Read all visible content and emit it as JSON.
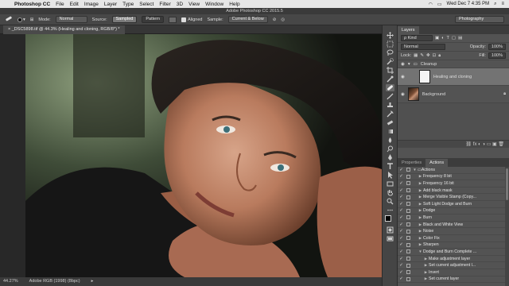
{
  "menubar": {
    "app": "Photoshop CC",
    "items": [
      "File",
      "Edit",
      "Image",
      "Layer",
      "Type",
      "Select",
      "Filter",
      "3D",
      "View",
      "Window",
      "Help"
    ],
    "clock": "Wed Dec 7  4:35 PM",
    "battery": "▭"
  },
  "window": {
    "title": "Adobe Photoshop CC 2015.5"
  },
  "options": {
    "mode_label": "Mode:",
    "mode_value": "Normal",
    "source_label": "Source:",
    "sampled_label": "Sampled",
    "pattern_label": "Pattern",
    "aligned_label": "Aligned",
    "sample_label": "Sample:",
    "sample_value": "Current & Below",
    "workspace": "Photography"
  },
  "document": {
    "tab_title": "_DSC5898.tif @ 44.3% (Healing and cloning, RGB/8*) *",
    "status_zoom": "44.27%",
    "status_profile": "Adobe RGB (1998) (8bpc)"
  },
  "layers_panel": {
    "tab": "Layers",
    "kind_label": "ρ Kind",
    "blend_mode": "Normal",
    "opacity_label": "Opacity:",
    "opacity_value": "100%",
    "lock_label": "Lock:",
    "fill_label": "Fill:",
    "fill_value": "100%",
    "group_name": "Cleanup",
    "layers": [
      "Healing and cloning",
      "Background"
    ],
    "footer_icons": "⛓ fx ◐ ◑ ▭ ▣ 🗑"
  },
  "actions_panel": {
    "tabs": [
      "Properties",
      "Actions"
    ],
    "items": [
      {
        "label": "Actions",
        "level": 0,
        "type": "set"
      },
      {
        "label": "Frequency 8 bit",
        "level": 1
      },
      {
        "label": "Frequency 16 bit",
        "level": 1
      },
      {
        "label": "Add black mask",
        "level": 1
      },
      {
        "label": "Merge Visible Stamp (Copy...",
        "level": 1
      },
      {
        "label": "Soft Light Dodge and Burn",
        "level": 1
      },
      {
        "label": "Dodge",
        "level": 1
      },
      {
        "label": "Burn",
        "level": 1
      },
      {
        "label": "Black and White View",
        "level": 1
      },
      {
        "label": "Noise",
        "level": 1
      },
      {
        "label": "Color Fix",
        "level": 1
      },
      {
        "label": "Sharpen",
        "level": 1
      },
      {
        "label": "Dodge and Burn Complete ...",
        "level": 1,
        "open": true
      },
      {
        "label": "Make adjustment layer",
        "level": 2
      },
      {
        "label": "Set current adjustment l...",
        "level": 2
      },
      {
        "label": "Invert",
        "level": 2
      },
      {
        "label": "Set current layer",
        "level": 2
      }
    ]
  },
  "colors": {
    "panel_bg": "#535353",
    "canvas_bg": "#282828",
    "selected_layer": "#737373"
  }
}
